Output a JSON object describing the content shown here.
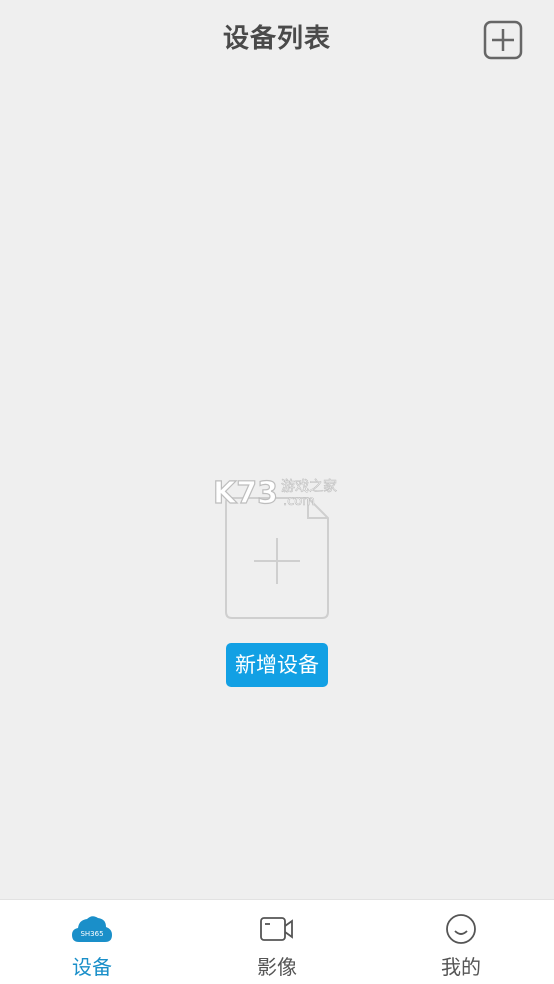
{
  "header": {
    "title": "设备列表",
    "add_icon": "plus-square-icon"
  },
  "empty_state": {
    "icon": "empty-document-plus-icon",
    "watermark_brand": "K73",
    "watermark_site": "游戏之家",
    "watermark_domain": ".com",
    "add_device_label": "新增设备"
  },
  "bottom_nav": {
    "items": [
      {
        "label": "设备",
        "icon": "cloud-logo-icon",
        "icon_text": "SH365",
        "active": true
      },
      {
        "label": "影像",
        "icon": "video-camera-icon",
        "active": false
      },
      {
        "label": "我的",
        "icon": "smiley-icon",
        "active": false
      }
    ]
  },
  "colors": {
    "background": "#efefef",
    "accent": "#12a0e4",
    "active_tab": "#1a8fc9",
    "title": "#4a4a4a"
  }
}
